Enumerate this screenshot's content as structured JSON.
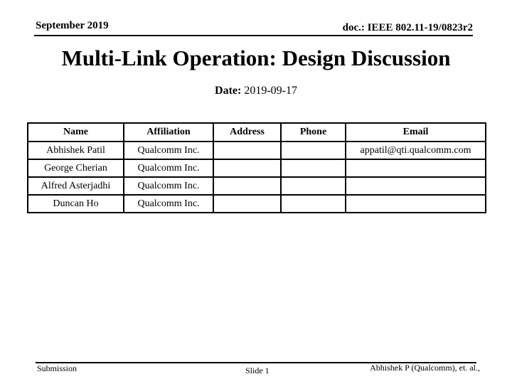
{
  "header": {
    "date_label": "September 2019",
    "doc_id": "doc.: IEEE 802.11-19/0823r2"
  },
  "title": "Multi-Link Operation: Design Discussion",
  "date": {
    "label": "Date:",
    "value": "2019-09-17"
  },
  "authors_table": {
    "columns": [
      "Name",
      "Affiliation",
      "Address",
      "Phone",
      "Email"
    ],
    "rows": [
      [
        "Abhishek Patil",
        "Qualcomm Inc.",
        "",
        "",
        "appatil@qti.qualcomm.com"
      ],
      [
        "George Cherian",
        "Qualcomm Inc.",
        "",
        "",
        ""
      ],
      [
        "Alfred Asterjadhi",
        "Qualcomm Inc.",
        "",
        "",
        ""
      ],
      [
        "Duncan Ho",
        "Qualcomm Inc.",
        "",
        "",
        ""
      ]
    ]
  },
  "footer": {
    "left": "Submission",
    "center": "Slide 1",
    "right": "Abhishek P (Qualcomm), et. al.,"
  }
}
